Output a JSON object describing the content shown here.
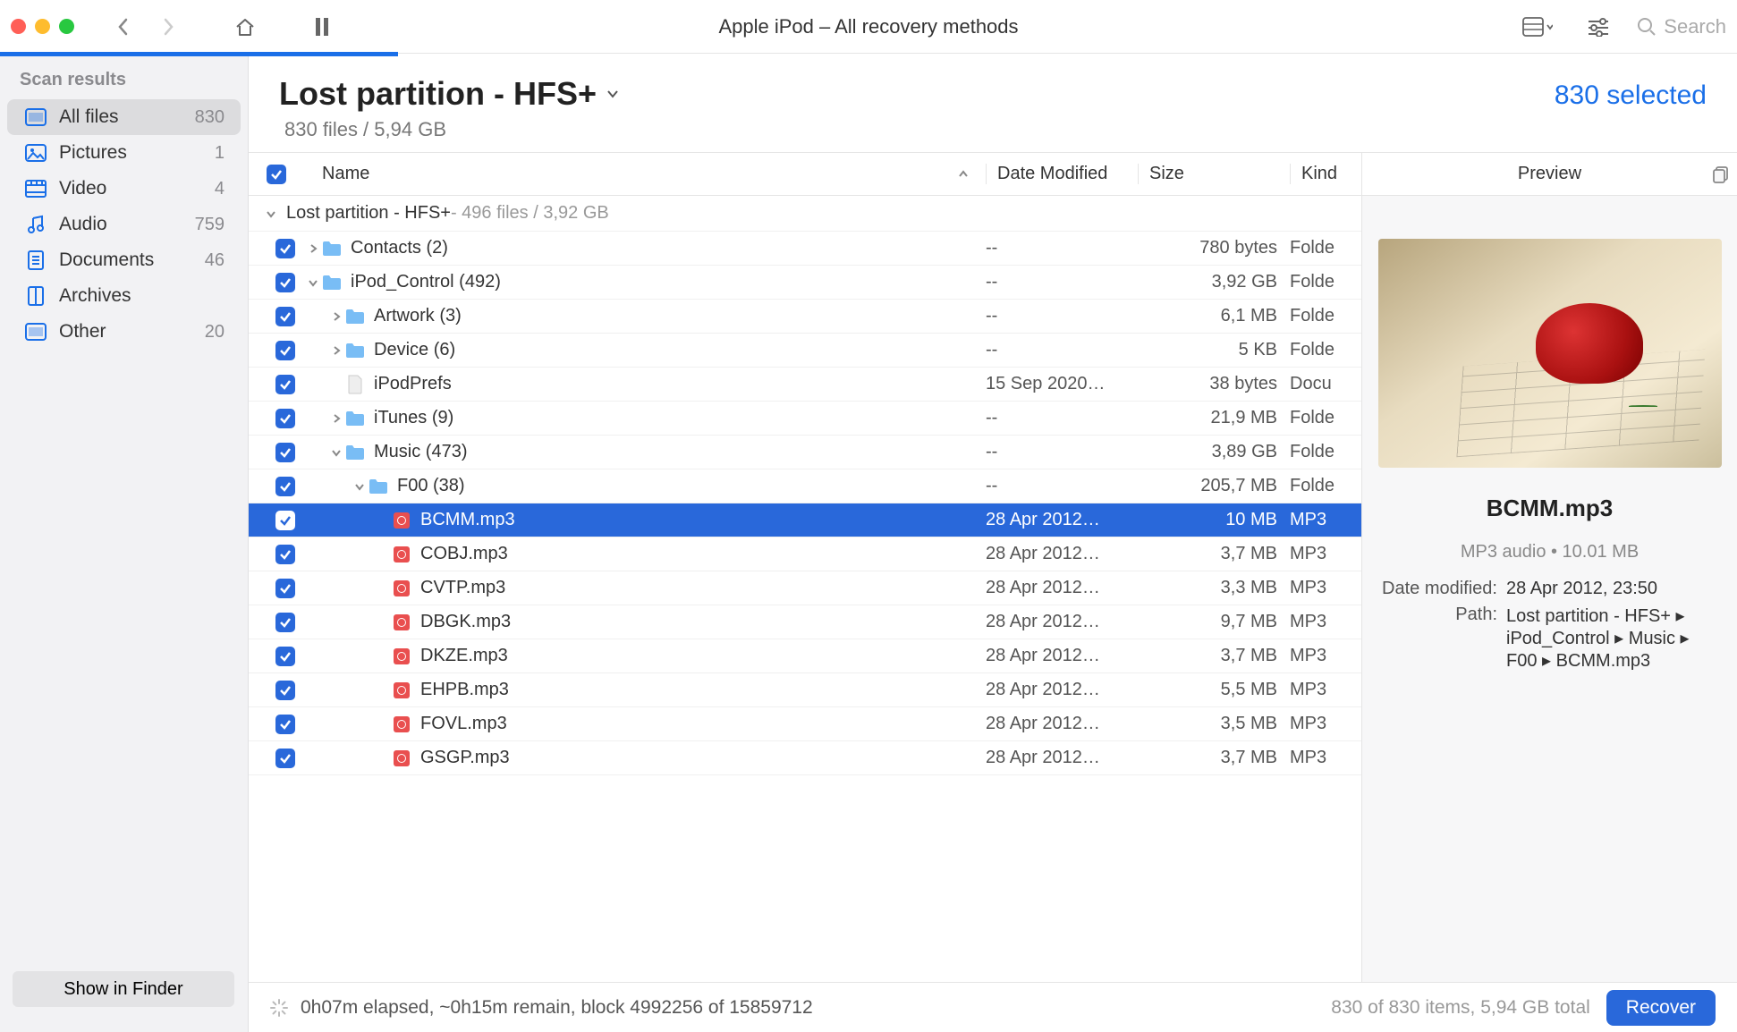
{
  "toolbar": {
    "title": "Apple iPod – All recovery methods",
    "search_placeholder": "Search"
  },
  "sidebar": {
    "header": "Scan results",
    "items": [
      {
        "label": "All files",
        "count": "830",
        "icon": "allfiles"
      },
      {
        "label": "Pictures",
        "count": "1",
        "icon": "pictures"
      },
      {
        "label": "Video",
        "count": "4",
        "icon": "video"
      },
      {
        "label": "Audio",
        "count": "759",
        "icon": "audio"
      },
      {
        "label": "Documents",
        "count": "46",
        "icon": "documents"
      },
      {
        "label": "Archives",
        "count": "",
        "icon": "archives"
      },
      {
        "label": "Other",
        "count": "20",
        "icon": "other"
      }
    ],
    "show_in_finder": "Show in Finder"
  },
  "main_header": {
    "title": "Lost partition - HFS+",
    "subtitle": "830 files / 5,94 GB",
    "selected": "830 selected"
  },
  "columns": {
    "name": "Name",
    "date": "Date Modified",
    "size": "Size",
    "kind": "Kind"
  },
  "group": {
    "label": "Lost partition - HFS+",
    "meta": " - 496 files / 3,92 GB"
  },
  "rows": [
    {
      "indent": 0,
      "expand": "right",
      "icon": "folder",
      "name": "Contacts (2)",
      "date": "--",
      "size": "780 bytes",
      "kind": "Folde"
    },
    {
      "indent": 0,
      "expand": "down",
      "icon": "folder",
      "name": "iPod_Control (492)",
      "date": "--",
      "size": "3,92 GB",
      "kind": "Folde"
    },
    {
      "indent": 1,
      "expand": "right",
      "icon": "folder",
      "name": "Artwork (3)",
      "date": "--",
      "size": "6,1 MB",
      "kind": "Folde"
    },
    {
      "indent": 1,
      "expand": "right",
      "icon": "folder",
      "name": "Device (6)",
      "date": "--",
      "size": "5 KB",
      "kind": "Folde"
    },
    {
      "indent": 1,
      "expand": "",
      "icon": "file",
      "name": "iPodPrefs",
      "date": "15 Sep 2020…",
      "size": "38 bytes",
      "kind": "Docu"
    },
    {
      "indent": 1,
      "expand": "right",
      "icon": "folder",
      "name": "iTunes (9)",
      "date": "--",
      "size": "21,9 MB",
      "kind": "Folde"
    },
    {
      "indent": 1,
      "expand": "down",
      "icon": "folder",
      "name": "Music (473)",
      "date": "--",
      "size": "3,89 GB",
      "kind": "Folde"
    },
    {
      "indent": 2,
      "expand": "down",
      "icon": "folder",
      "name": "F00 (38)",
      "date": "--",
      "size": "205,7 MB",
      "kind": "Folde"
    },
    {
      "indent": 3,
      "expand": "",
      "icon": "mp3",
      "name": "BCMM.mp3",
      "date": "28 Apr 2012…",
      "size": "10 MB",
      "kind": "MP3",
      "selected": true
    },
    {
      "indent": 3,
      "expand": "",
      "icon": "mp3",
      "name": "COBJ.mp3",
      "date": "28 Apr 2012…",
      "size": "3,7 MB",
      "kind": "MP3"
    },
    {
      "indent": 3,
      "expand": "",
      "icon": "mp3",
      "name": "CVTP.mp3",
      "date": "28 Apr 2012…",
      "size": "3,3 MB",
      "kind": "MP3"
    },
    {
      "indent": 3,
      "expand": "",
      "icon": "mp3",
      "name": "DBGK.mp3",
      "date": "28 Apr 2012…",
      "size": "9,7 MB",
      "kind": "MP3"
    },
    {
      "indent": 3,
      "expand": "",
      "icon": "mp3",
      "name": "DKZE.mp3",
      "date": "28 Apr 2012…",
      "size": "3,7 MB",
      "kind": "MP3"
    },
    {
      "indent": 3,
      "expand": "",
      "icon": "mp3",
      "name": "EHPB.mp3",
      "date": "28 Apr 2012…",
      "size": "5,5 MB",
      "kind": "MP3"
    },
    {
      "indent": 3,
      "expand": "",
      "icon": "mp3",
      "name": "FOVL.mp3",
      "date": "28 Apr 2012…",
      "size": "3,5 MB",
      "kind": "MP3"
    },
    {
      "indent": 3,
      "expand": "",
      "icon": "mp3",
      "name": "GSGP.mp3",
      "date": "28 Apr 2012…",
      "size": "3,7 MB",
      "kind": "MP3"
    }
  ],
  "preview": {
    "header": "Preview",
    "name": "BCMM.mp3",
    "meta": "MP3 audio • 10.01 MB",
    "date_label": "Date modified:",
    "date_value": "28 Apr 2012, 23:50",
    "path_label": "Path:",
    "path_value": "Lost partition - HFS+ ▸ iPod_Control ▸ Music ▸ F00 ▸ BCMM.mp3"
  },
  "footer": {
    "status": "0h07m elapsed, ~0h15m remain, block 4992256 of 15859712",
    "stats": "830 of 830 items, 5,94 GB total",
    "recover": "Recover"
  }
}
